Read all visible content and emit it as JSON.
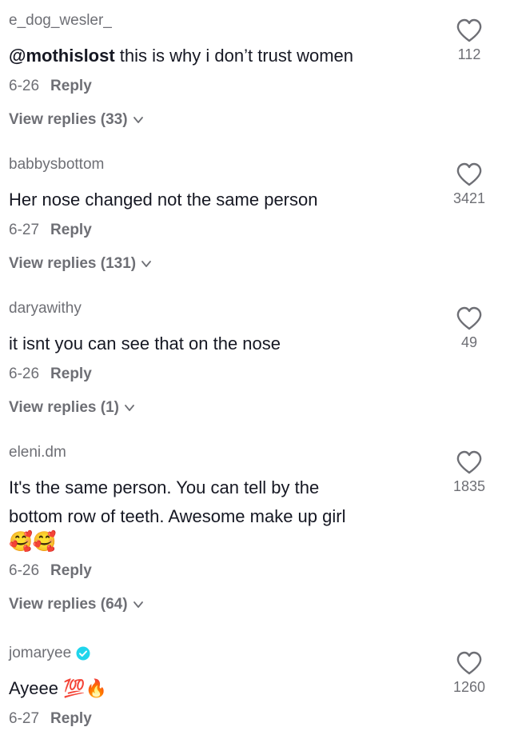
{
  "comments": [
    {
      "username": "e_dog_wesler_",
      "mention": "@mothislost",
      "text": " this is why i don’t trust women",
      "date": "6-26",
      "reply_label": "Reply",
      "view_replies": "View replies (33)",
      "likes": "112"
    },
    {
      "username": "babbysbottom",
      "text": "Her nose changed not the same person",
      "date": "6-27",
      "reply_label": "Reply",
      "view_replies": "View replies (131)",
      "likes": "3421"
    },
    {
      "username": "daryawithy",
      "text": "it isnt you can see that on the nose",
      "date": "6-26",
      "reply_label": "Reply",
      "view_replies": "View replies (1)",
      "likes": "49"
    },
    {
      "username": "eleni.dm",
      "text_line1": "It's the same person. You can tell by the",
      "text_line2": "bottom row of teeth. Awesome make up girl",
      "emoji": "🥰🥰",
      "date": "6-26",
      "reply_label": "Reply",
      "view_replies": "View replies (64)",
      "likes": "1835"
    },
    {
      "username": "jomaryee",
      "text": "Ayeee 💯🔥",
      "date": "6-27",
      "reply_label": "Reply",
      "likes": "1260"
    }
  ],
  "colors": {
    "primary_text": "#161823",
    "secondary_text": "#6e6f75",
    "verified": "#20d5ec"
  },
  "icons": {
    "like": "heart-outline-icon",
    "expand": "chevron-down-icon",
    "verified": "verified-badge-icon"
  }
}
